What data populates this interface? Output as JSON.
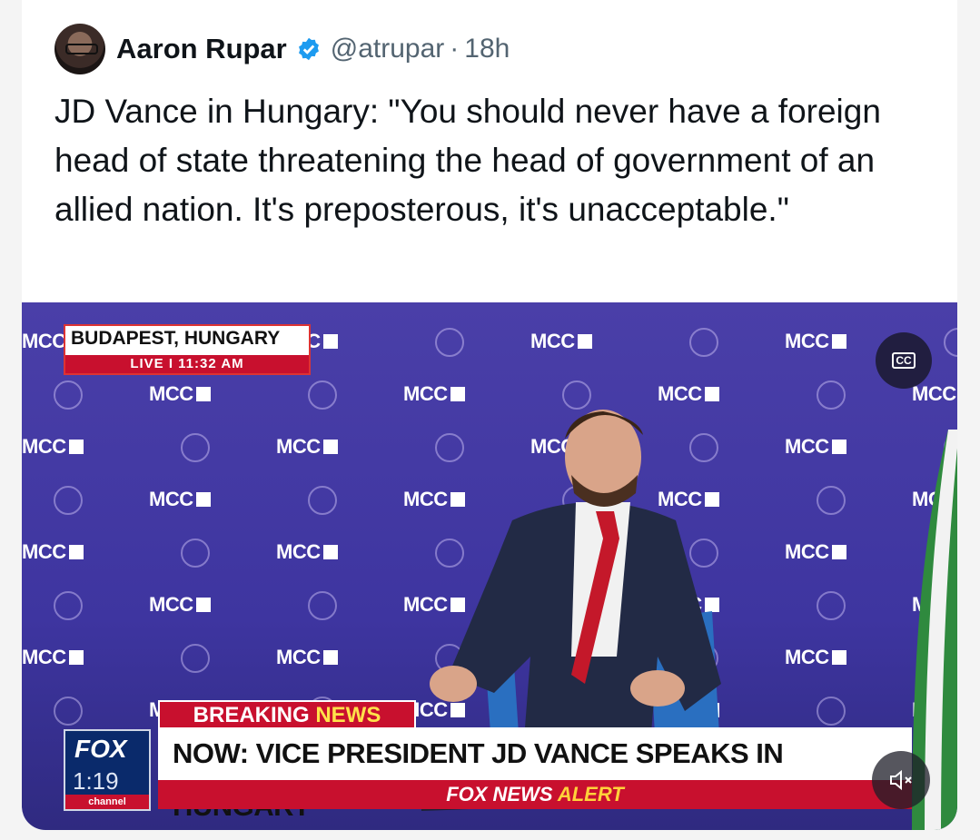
{
  "tweet": {
    "author_name": "Aaron Rupar",
    "handle": "@atrupar",
    "separator": "·",
    "time": "18h",
    "text": "JD Vance in Hungary: \"You should never have a foreign head of state threatening the head of government of an allied nation. It's preposterous, it's unacceptable.\""
  },
  "video": {
    "location": "BUDAPEST, HUNGARY",
    "live_text": "LIVE  I  11:32 AM",
    "breaking_word1": "BREAKING",
    "breaking_word2": "NEWS",
    "headline": "NOW: VICE PRESIDENT JD VANCE SPEAKS IN HUNGARY",
    "alert_brand": "FOX NEWS",
    "alert_word": "ALERT",
    "channel_logo": "FOX",
    "channel_clock": "1:19",
    "channel_sub": "channel",
    "backdrop_logo": "MCC",
    "cc_label": "CC"
  },
  "colors": {
    "verified": "#1d9bf0",
    "backdrop": "#4a3fa8",
    "fox_red": "#c8102e"
  },
  "icons": [
    "verified-badge-icon",
    "closed-captions-icon",
    "mute-icon"
  ]
}
